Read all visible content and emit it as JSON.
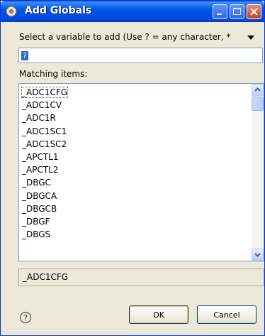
{
  "window": {
    "title": "Add Globals"
  },
  "prompt": {
    "text": "Select a variable to add (Use ? = any character, *"
  },
  "filter": {
    "value": "?"
  },
  "matching": {
    "label": "Matching items:",
    "items": [
      "_ADC1CFG",
      "_ADC1CV",
      "_ADC1R",
      "_ADC1SC1",
      "_ADC1SC2",
      "_APCTL1",
      "_APCTL2",
      "_DBGC",
      "_DBGCA",
      "_DBGCB",
      "_DBGF",
      "_DBGS"
    ]
  },
  "selected": {
    "text": "_ADC1CFG"
  },
  "buttons": {
    "ok": "OK",
    "cancel": "Cancel"
  },
  "icons": [
    "app-icon",
    "minimize-icon",
    "maximize-icon",
    "close-icon",
    "view-menu-icon",
    "scroll-up-icon",
    "scroll-down-icon",
    "help-icon"
  ],
  "colors": {
    "title_bar": "#0058e6",
    "dialog_bg": "#ece9d8",
    "selection": "#316ac5"
  }
}
